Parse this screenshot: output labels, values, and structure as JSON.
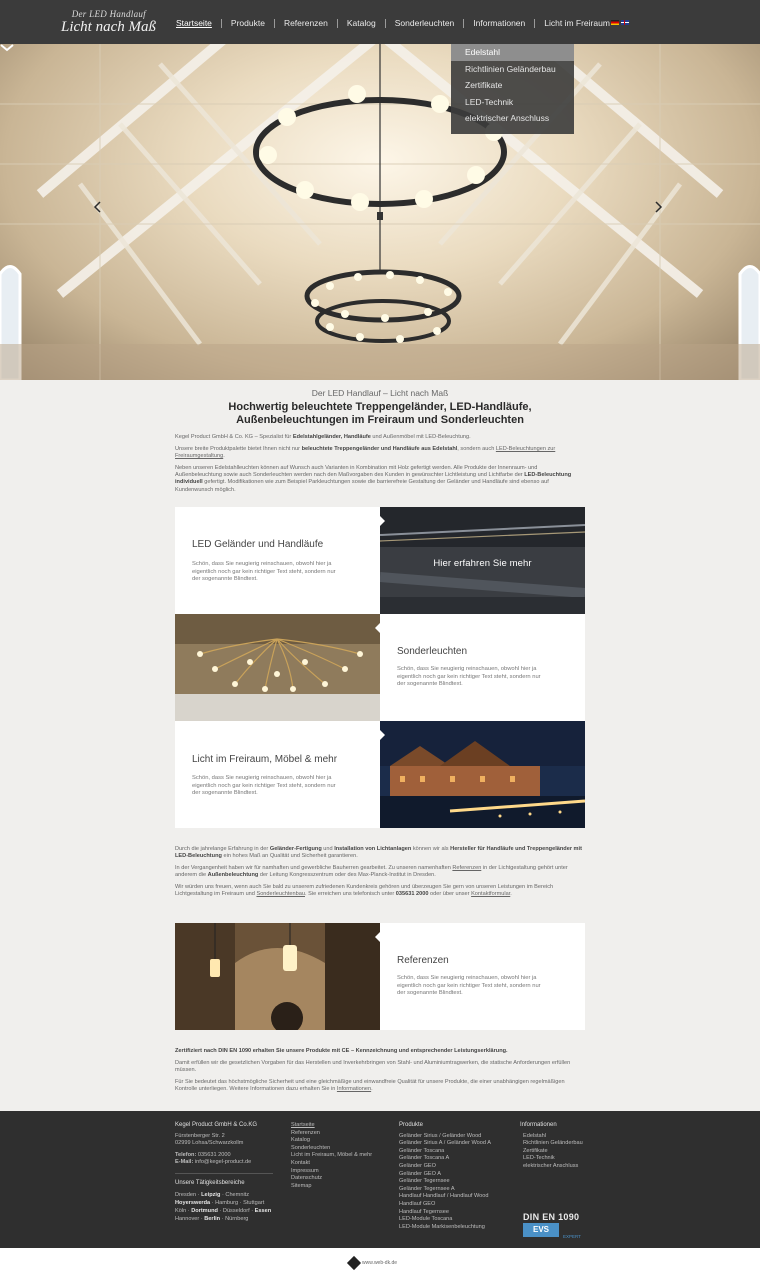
{
  "logo": {
    "tagline": "Der LED Handlauf",
    "name": "Licht nach Maß"
  },
  "nav": {
    "items": [
      {
        "label": "Startseite",
        "active": true
      },
      {
        "label": "Produkte"
      },
      {
        "label": "Referenzen"
      },
      {
        "label": "Katalog"
      },
      {
        "label": "Sonderleuchten"
      },
      {
        "label": "Informationen"
      },
      {
        "label": "Licht im Freiraum"
      }
    ],
    "languages": [
      "de",
      "en"
    ]
  },
  "dropdown": {
    "items": [
      "Edelstahl",
      "Richtlinien Geländerbau",
      "Zertifikate",
      "LED-Technik",
      "elektrischer Anschluss"
    ],
    "highlighted": "Edelstahl"
  },
  "intro": {
    "subtitle": "Der LED Handlauf – Licht nach Maß",
    "title": "Hochwertig beleuchtete Treppengeländer, LED-Handläufe, Außenbeleuchtungen im Freiraum und Sonderleuchten",
    "p1a": "Kegel Product GmbH & Co. KG – Spezialist für ",
    "p1b": "Edelstahlgeländer, Handläufe",
    "p1c": " und Außenmöbel mit LED-Beleuchtung.",
    "p2a": "Unsere breite Produktpalette bietet Ihnen nicht nur ",
    "p2b": "beleuchtete Treppengeländer und Handläufe aus Edelstahl",
    "p2c": ", sondern auch ",
    "p2d": "LED-Beleuchtungen zur Freiraumgestaltung",
    "p2e": ".",
    "p3": "Neben unseren Edelstahlleuchten können auf Wunsch auch Varianten in Kombination mit Holz gefertigt werden. Alle Produkte der Innenraum- und Außenbeleuchtung sowie auch Sonderleuchten werden nach den Maßvorgaben des Kunden in gewünschter Lichtleistung und Lichtfarbe der ",
    "p3b": "LED-Beleuchtung individuell",
    "p3c": " gefertigt. Modifikationen wie zum Beispiel Parkleuchtungen sowie die barrierefreie Gestaltung der Geländer und Handläufe sind ebenso auf Kundenwunsch möglich."
  },
  "tiles": {
    "t1": {
      "title": "LED Geländer und Handläufe",
      "desc": "Schön, dass Sie neugierig reinschauen, obwohl hier ja eigentlich noch gar kein richtiger Text steht, sondern nur der sogenannte Blindtext."
    },
    "t1_more": "Hier erfahren Sie mehr",
    "t2": {
      "title": "Sonderleuchten",
      "desc": "Schön, dass Sie neugierig reinschauen, obwohl hier ja eigentlich noch gar kein richtiger Text steht, sondern nur der sogenannte Blindtext."
    },
    "t3": {
      "title": "Licht im Freiraum, Möbel & mehr",
      "desc": "Schön, dass Sie neugierig reinschauen, obwohl hier ja eigentlich noch gar kein richtiger Text steht, sondern nur der sogenannte Blindtext."
    },
    "t4": {
      "title": "Referenzen",
      "desc": "Schön, dass Sie neugierig reinschauen, obwohl hier ja eigentlich noch gar kein richtiger Text steht, sondern nur der sogenannte Blindtext."
    }
  },
  "mid": {
    "p1a": "Durch die jahrelange Erfahrung in der ",
    "p1b": "Geländer-Fertigung",
    "p1c": " und ",
    "p1d": "Installation von Lichtanlagen",
    "p1e": " können wir als ",
    "p1f": "Hersteller für Handläufe und Treppengeländer mit LED-Beleuchtung",
    "p1g": " ein hohes Maß an Qualität und Sicherheit garantieren.",
    "p2a": "In der Vergangenheit haben wir für namhaften und gewerbliche Bauherren gearbeitet. Zu unseren namenhaften ",
    "p2b": "Referenzen",
    "p2c": " in der Lichtgestaltung gehört unter anderem die ",
    "p2d": "Außenbeleuchtung",
    "p2e": " der Leitung Kongresszentrum oder des Max-Planck-Institut in Dresden.",
    "p3a": "Wir würden uns freuen, wenn auch Sie bald zu unserem zufriedenen Kundenkreis gehören und überzeugen Sie gern von unseren Leistungen im Bereich Lichtgestaltung im Freiraum und ",
    "p3b": "Sonderleuchtenbau",
    "p3c": ". Sie erreichen uns telefonisch unter ",
    "p3d": "035631 2000",
    "p3e": " oder über unser ",
    "p3f": "Kontaktformular",
    "p3g": "."
  },
  "bottomtext": {
    "p1": "Zertifiziert nach DIN EN 1090 erhalten Sie unsere Produkte mit CE – Kennzeichnung und entsprechender Leistungserklärung.",
    "p2": "Damit erfüllen wir die gesetzlichen Vorgaben für das Herstellen und Inverkehrbringen von Stahl- und Aluminiumtragwerken, die statische Anforderungen erfüllen müssen.",
    "p3a": "Für Sie bedeutet das höchstmögliche Sicherheit und eine gleichmäßige und einwandfreie Qualität für unsere Produkte, die einer unabhängigen regelmäßigen Kontrolle unterliegen. Weitere Informationen dazu erhalten Sie in ",
    "p3b": "Informationen",
    "p3c": "."
  },
  "footer": {
    "company": {
      "name": "Kegel Product GmbH & Co.KG",
      "street": "Fürstenberger Str. 2",
      "city": "02999 Lohsa/Schwarzkollm",
      "phone_label": "Telefon:",
      "phone": "035631 2000",
      "email_label": "E-Mail:",
      "email": "info@kegel-product.de",
      "areas_title": "Unsere Tätigkeitsbereiche",
      "cities": [
        [
          "Dresden",
          "Leipzig",
          "Chemnitz"
        ],
        [
          "Hoyerswerda",
          "Hamburg",
          "Stuttgart"
        ],
        [
          "Köln",
          "Dortmund",
          "Düsseldorf",
          "Essen"
        ],
        [
          "Hannover",
          "Berlin",
          "Nürnberg"
        ]
      ]
    },
    "links": [
      "Startseite",
      "Referenzen",
      "Katalog",
      "Sonderleuchten",
      "Licht im Freiraum, Möbel & mehr",
      "Kontakt",
      "Impressum",
      "Datenschutz",
      "Sitemap"
    ],
    "products_title": "Produkte",
    "products": [
      "Geländer Sirius / Geländer Wood",
      "Geländer Sirius A / Geländer Wood A",
      "Geländer Toscana",
      "Geländer Toscana A",
      "Geländer GEO",
      "Geländer GEO A",
      "Geländer Tegernsee",
      "Geländer Tegernsee A",
      "Handlauf Handlauf / Handlauf Wood",
      "Handlauf GEO",
      "Handlauf Tegernsee",
      "LED-Module Toscana",
      "LED-Module Markisenbeleuchtung"
    ],
    "info_title": "Informationen",
    "info": [
      "Edelstahl",
      "Richtlinien Geländerbau",
      "Zertifikate",
      "LED-Technik",
      "elektrischer Anschluss"
    ],
    "cert_title": "DIN EN 1090",
    "cert_logo": "EVS",
    "cert_sub": "EXPERT"
  },
  "credit": "www.web-dk.de"
}
